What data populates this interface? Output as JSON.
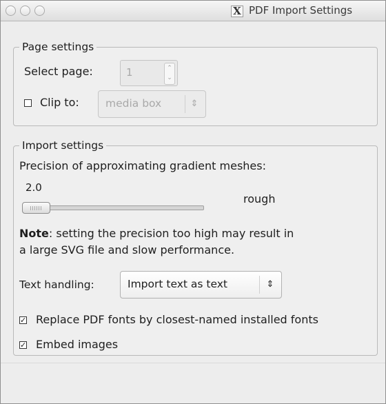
{
  "window": {
    "title": "PDF Import Settings"
  },
  "page_settings": {
    "title": "Page settings",
    "select_page_label": "Select page:",
    "page_value": "1",
    "clip_to_label": "Clip to:",
    "clip_to_checked": false,
    "clip_to_value": "media box"
  },
  "import_settings": {
    "title": "Import settings",
    "precision_label": "Precision of approximating gradient meshes:",
    "precision_value": "2.0",
    "precision_level": 0.1,
    "precision_quality": "rough",
    "note_bold": "Note",
    "note_text": ": setting the precision too high may result in",
    "note_text_line2": "a large SVG file and slow performance.",
    "text_handling_label": "Text handling:",
    "text_handling_value": "Import text as text",
    "replace_fonts_label": "Replace PDF fonts by closest-named installed fonts",
    "replace_fonts_checked": true,
    "embed_images_label": "Embed images",
    "embed_images_checked": true
  },
  "icons": {
    "window_close": "close-traffic-light",
    "window_minimize": "minimize-traffic-light",
    "window_zoom": "zoom-traffic-light",
    "x11": "x11-icon",
    "spin": "spin-arrows-icon",
    "combo": "updown-arrows-icon"
  },
  "colors": {
    "window_bg": "#ededed",
    "group_border": "#b9b9b9",
    "disabled_text": "#a9a9a9"
  }
}
